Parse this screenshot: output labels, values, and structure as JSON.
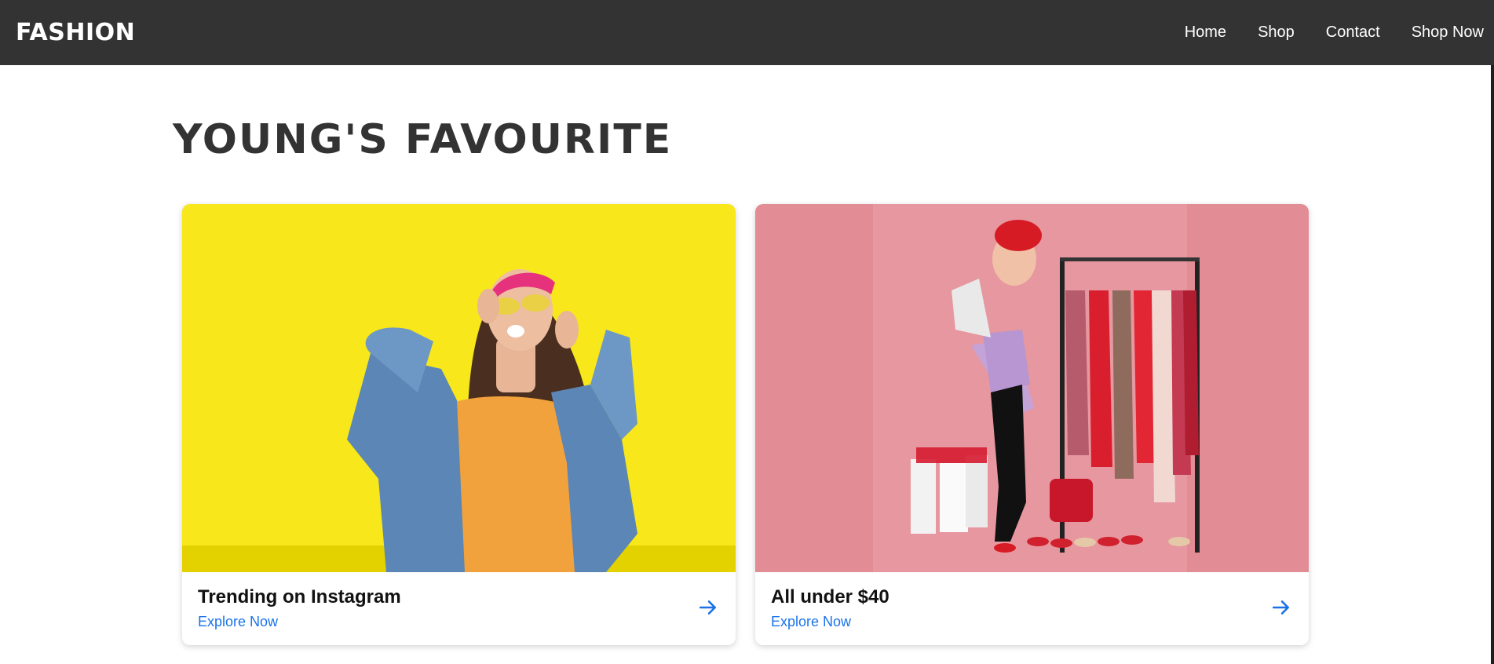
{
  "nav": {
    "brand": "FASHION",
    "links": [
      "Home",
      "Shop",
      "Contact",
      "Shop Now"
    ]
  },
  "section": {
    "title": "YOUNG'S FAVOURITE"
  },
  "cards": [
    {
      "title": "Trending on Instagram",
      "link": "Explore Now",
      "image_alt": "young woman in denim jacket and yellow sunglasses against yellow wall",
      "icon": "arrow-right-icon"
    },
    {
      "title": "All under $40",
      "link": "Explore Now",
      "image_alt": "woman in red beret beside clothing rack on pink background",
      "icon": "arrow-right-icon"
    }
  ],
  "colors": {
    "navbar": "#333333",
    "accent": "#1a73e8",
    "card_bg_1": "#f7e500",
    "card_bg_2": "#e38a93"
  }
}
